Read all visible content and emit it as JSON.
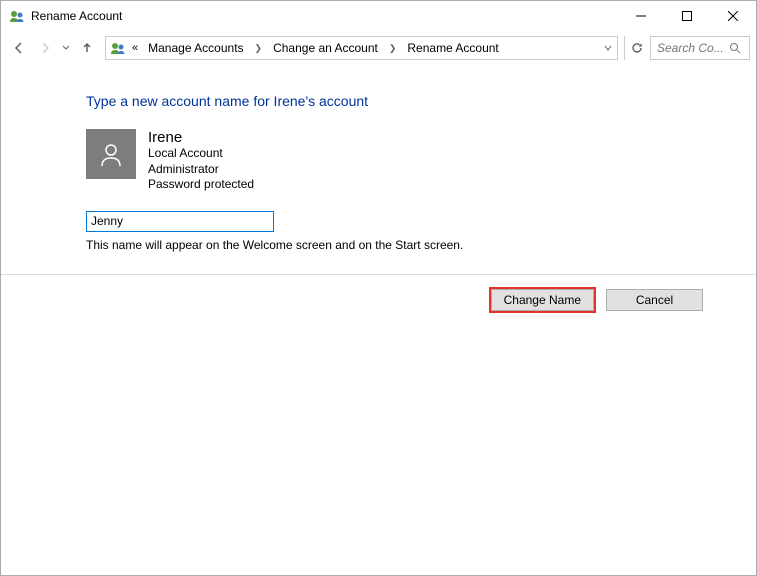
{
  "window": {
    "title": "Rename Account"
  },
  "breadcrumb": {
    "prefix": "«",
    "items": [
      "Manage Accounts",
      "Change an Account",
      "Rename Account"
    ]
  },
  "search": {
    "placeholder": "Search Co..."
  },
  "page": {
    "heading": "Type a new account name for Irene's account",
    "account": {
      "name": "Irene",
      "type": "Local Account",
      "role": "Administrator",
      "password_status": "Password protected"
    },
    "input_value": "Jenny",
    "hint": "This name will appear on the Welcome screen and on the Start screen."
  },
  "buttons": {
    "primary": "Change Name",
    "secondary": "Cancel"
  }
}
